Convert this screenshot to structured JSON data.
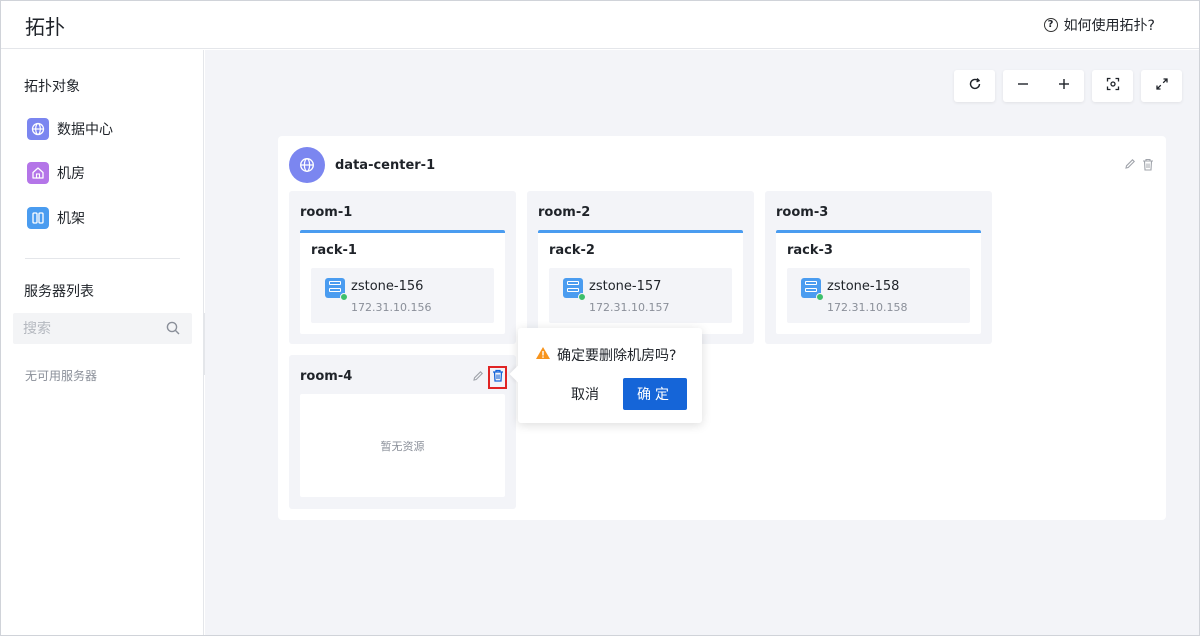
{
  "header": {
    "title": "拓扑",
    "help_label": "如何使用拓扑?"
  },
  "sidebar": {
    "objects_title": "拓扑对象",
    "objects": [
      {
        "label": "数据中心",
        "icon": "globe-icon",
        "color": "#7b86f0"
      },
      {
        "label": "机房",
        "icon": "house-icon",
        "color": "#b475e8"
      },
      {
        "label": "机架",
        "icon": "rack-icon",
        "color": "#4a9cf0"
      }
    ],
    "servers_title": "服务器列表",
    "search_placeholder": "搜索",
    "empty_text": "无可用服务器"
  },
  "toolbar": {
    "icons": [
      "refresh-icon",
      "zoom-out-icon",
      "zoom-in-icon",
      "focus-icon",
      "fullscreen-icon"
    ]
  },
  "datacenter": {
    "name": "data-center-1",
    "rooms": [
      {
        "name": "room-1",
        "rack": {
          "name": "rack-1",
          "server": {
            "name": "zstone-156",
            "ip": "172.31.10.156"
          }
        }
      },
      {
        "name": "room-2",
        "rack": {
          "name": "rack-2",
          "server": {
            "name": "zstone-157",
            "ip": "172.31.10.157"
          }
        }
      },
      {
        "name": "room-3",
        "rack": {
          "name": "rack-3",
          "server": {
            "name": "zstone-158",
            "ip": "172.31.10.158"
          }
        }
      },
      {
        "name": "room-4",
        "empty_text": "暂无资源"
      }
    ]
  },
  "popconfirm": {
    "message": "确定要删除机房吗?",
    "cancel_label": "取消",
    "ok_label": "确定"
  },
  "colors": {
    "primary": "#1565d8",
    "rack_accent": "#4a9cf0",
    "warning": "#f7941d",
    "online": "#3dbf6b",
    "highlight": "#e02424"
  }
}
